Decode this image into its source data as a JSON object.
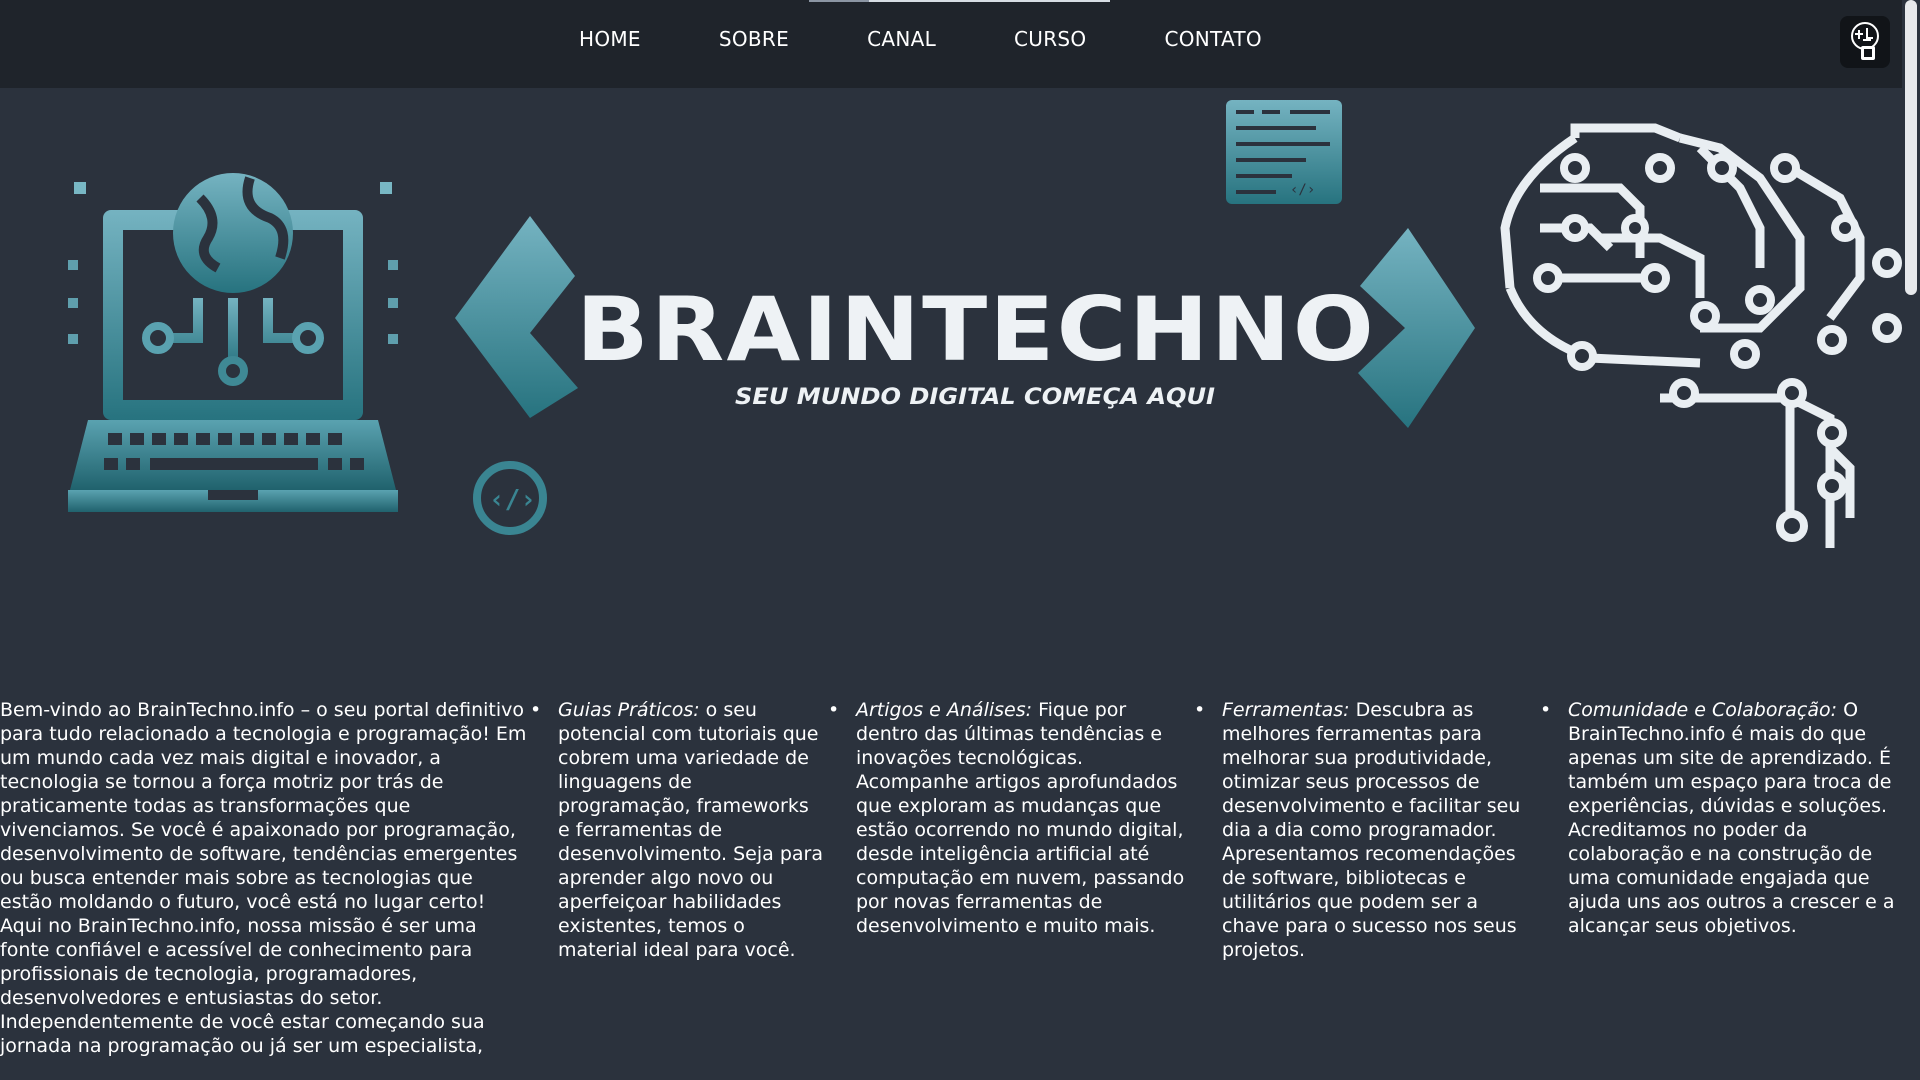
{
  "nav": {
    "items": [
      "HOME",
      "SOBRE",
      "CANAL",
      "CURSO",
      "CONTATO"
    ]
  },
  "hero": {
    "brand": "BRAINTECHNO",
    "tagline": "SEU MUNDO DIGITAL COMEÇA AQUI"
  },
  "intro": {
    "p1": "Bem-vindo ao BrainTechno.info – o seu portal definitivo para tudo relacionado a tecnologia e programação! Em um mundo cada vez mais digital e inovador, a tecnologia se tornou a força motriz por trás de praticamente todas as transformações que vivenciamos. Se você é apaixonado por programação, desenvolvimento de software, tendências emergentes ou busca entender mais sobre as tecnologias que estão moldando o futuro, você está no lugar certo!",
    "p2": "Aqui no BrainTechno.info, nossa missão é ser uma fonte confiável e acessível de conhecimento para profissionais de tecnologia, programadores, desenvolvedores e entusiastas do setor.",
    "p3": "Independentemente de você estar começando sua jornada na programação ou já ser um especialista,"
  },
  "features": [
    {
      "title": "Guias Práticos:",
      "text": " o seu potencial com tutoriais que cobrem uma variedade de linguagens de programação, frameworks e ferramentas de desenvolvimento. Seja para aprender algo novo ou aperfeiçoar habilidades existentes, temos o material ideal para você."
    },
    {
      "title": "Artigos e Análises:",
      "text": " Fique por dentro das últimas tendências e inovações tecnológicas. Acompanhe artigos aprofundados que exploram as mudanças que estão ocorrendo no mundo digital, desde inteligência artificial até computação em nuvem, passando por novas ferramentas de desenvolvimento e muito mais."
    },
    {
      "title": "Ferramentas:",
      "text": " Descubra as melhores ferramentas para melhorar sua produtividade, otimizar seus processos de desenvolvimento e facilitar seu dia a dia como programador. Apresentamos recomendações de software, bibliotecas e utilitários que podem ser a chave para o sucesso nos seus projetos."
    },
    {
      "title": "Comunidade e Colaboração:",
      "text": " O BrainTechno.info é mais do que apenas um site de aprendizado. É também um espaço para troca de experiências, dúvidas e soluções. Acreditamos no poder da colaboração e na construção de uma comunidade engajada que ajuda uns aos outros a crescer e a alcançar seus objetivos."
    }
  ],
  "icons": {
    "nav_logo": "brain-logo-icon",
    "laptop": "laptop-globe-icon",
    "window": "code-window-icon",
    "code_circle": "code-circle-icon",
    "circuit": "circuit-brain-icon"
  }
}
